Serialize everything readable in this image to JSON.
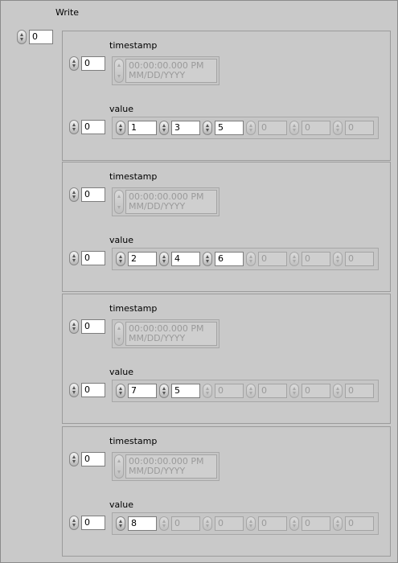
{
  "array": {
    "label": "Write",
    "index": "0",
    "elements": [
      {
        "timestamp_label": "timestamp",
        "timestamp_index": "0",
        "timestamp_time": "00:00:00.000 PM",
        "timestamp_date": "MM/DD/YYYY",
        "value_label": "value",
        "value_index": "0",
        "values": [
          {
            "v": "1",
            "active": true
          },
          {
            "v": "3",
            "active": true
          },
          {
            "v": "5",
            "active": true
          },
          {
            "v": "0",
            "active": false
          },
          {
            "v": "0",
            "active": false
          },
          {
            "v": "0",
            "active": false
          }
        ]
      },
      {
        "timestamp_label": "timestamp",
        "timestamp_index": "0",
        "timestamp_time": "00:00:00.000 PM",
        "timestamp_date": "MM/DD/YYYY",
        "value_label": "value",
        "value_index": "0",
        "values": [
          {
            "v": "2",
            "active": true
          },
          {
            "v": "4",
            "active": true
          },
          {
            "v": "6",
            "active": true
          },
          {
            "v": "0",
            "active": false
          },
          {
            "v": "0",
            "active": false
          },
          {
            "v": "0",
            "active": false
          }
        ]
      },
      {
        "timestamp_label": "timestamp",
        "timestamp_index": "0",
        "timestamp_time": "00:00:00.000 PM",
        "timestamp_date": "MM/DD/YYYY",
        "value_label": "value",
        "value_index": "0",
        "values": [
          {
            "v": "7",
            "active": true
          },
          {
            "v": "5",
            "active": true
          },
          {
            "v": "0",
            "active": false
          },
          {
            "v": "0",
            "active": false
          },
          {
            "v": "0",
            "active": false
          },
          {
            "v": "0",
            "active": false
          }
        ]
      },
      {
        "timestamp_label": "timestamp",
        "timestamp_index": "0",
        "timestamp_time": "00:00:00.000 PM",
        "timestamp_date": "MM/DD/YYYY",
        "value_label": "value",
        "value_index": "0",
        "values": [
          {
            "v": "8",
            "active": true
          },
          {
            "v": "0",
            "active": false
          },
          {
            "v": "0",
            "active": false
          },
          {
            "v": "0",
            "active": false
          },
          {
            "v": "0",
            "active": false
          },
          {
            "v": "0",
            "active": false
          }
        ]
      }
    ]
  }
}
